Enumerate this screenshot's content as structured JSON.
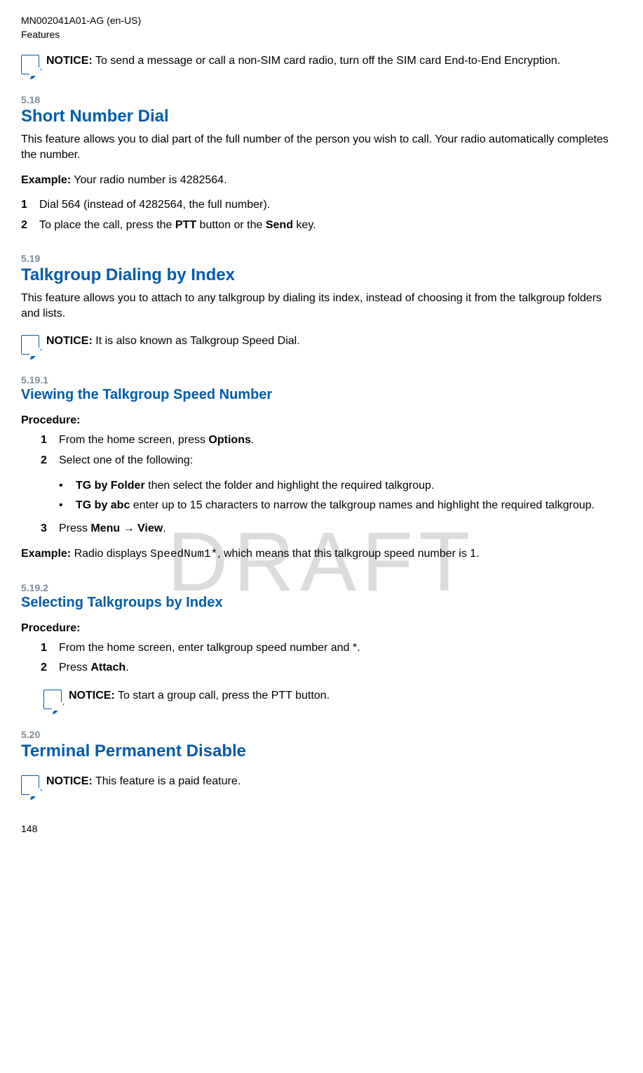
{
  "header": {
    "docnum": "MN002041A01-AG (en-US)",
    "section": "Features"
  },
  "watermark": "DRAFT",
  "notice1": {
    "label": "NOTICE:",
    "text": " To send a message or call a non-SIM card radio, turn off the SIM card End-to-End Encryption."
  },
  "sec518": {
    "num": "5.18",
    "title": "Short Number Dial",
    "intro": "This feature allows you to dial part of the full number of the person you wish to call. Your radio automatically completes the number.",
    "example_label": "Example:",
    "example_text": " Your radio number is 4282564.",
    "steps": [
      {
        "n": "1",
        "text": "Dial 564 (instead of 4282564, the full number)."
      },
      {
        "n": "2",
        "pre": "To place the call, press the ",
        "b1": "PTT",
        "mid": " button or the ",
        "b2": "Send",
        "post": " key."
      }
    ]
  },
  "sec519": {
    "num": "5.19",
    "title": "Talkgroup Dialing by Index",
    "intro": "This feature allows you to attach to any talkgroup by dialing its index, instead of choosing it from the talkgroup folders and lists.",
    "notice": {
      "label": "NOTICE:",
      "text": " It is also known as Talkgroup Speed Dial."
    }
  },
  "sec5191": {
    "num": "5.19.1",
    "title": "Viewing the Talkgroup Speed Number",
    "proc": "Procedure:",
    "s1": {
      "n": "1",
      "pre": "From the home screen, press ",
      "b": "Options",
      "post": "."
    },
    "s2": {
      "n": "2",
      "text": "Select one of the following:"
    },
    "bullets": [
      {
        "b": "TG by Folder",
        "text": " then select the folder and highlight the required talkgroup."
      },
      {
        "b": "TG by abc",
        "text": " enter up to 15 characters to narrow the talkgroup names and highlight the required talkgroup."
      }
    ],
    "s3": {
      "n": "3",
      "pre": "Press ",
      "b1": "Menu",
      "arrow": " → ",
      "b2": "View",
      "post": "."
    },
    "example_label": "Example:",
    "example_pre": " Radio displays ",
    "example_code": "SpeedNum1*",
    "example_post": ", which means that this talkgroup speed number is 1."
  },
  "sec5192": {
    "num": "5.19.2",
    "title": "Selecting Talkgroups by Index",
    "proc": "Procedure:",
    "s1": {
      "n": "1",
      "text": "From the home screen, enter talkgroup speed number and *."
    },
    "s2": {
      "n": "2",
      "pre": "Press ",
      "b": "Attach",
      "post": "."
    },
    "notice": {
      "label": "NOTICE:",
      "text": " To start a group call, press the PTT button."
    }
  },
  "sec520": {
    "num": "5.20",
    "title": "Terminal Permanent Disable",
    "notice": {
      "label": "NOTICE:",
      "text": " This feature is a paid feature."
    }
  },
  "pagenum": "148"
}
